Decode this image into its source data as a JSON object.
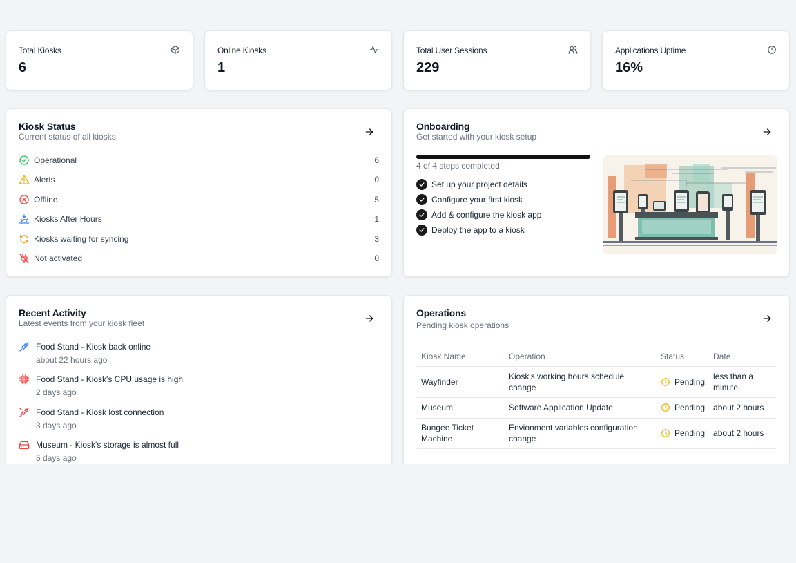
{
  "stats": [
    {
      "label": "Total Kiosks",
      "value": "6",
      "icon": "box-icon"
    },
    {
      "label": "Online Kiosks",
      "value": "1",
      "icon": "activity-icon"
    },
    {
      "label": "Total User Sessions",
      "value": "229",
      "icon": "users-icon"
    },
    {
      "label": "Applications Uptime",
      "value": "16%",
      "icon": "clock-icon"
    }
  ],
  "kiosk_status": {
    "title": "Kiosk Status",
    "subtitle": "Current status of all kiosks",
    "items": [
      {
        "label": "Operational",
        "count": "6",
        "icon": "check-circle-icon",
        "color": "#22c55e"
      },
      {
        "label": "Alerts",
        "count": "0",
        "icon": "warning-triangle-icon",
        "color": "#eab308"
      },
      {
        "label": "Offline",
        "count": "5",
        "icon": "x-circle-icon",
        "color": "#ef4444"
      },
      {
        "label": "Kiosks After Hours",
        "count": "1",
        "icon": "sunset-icon",
        "color": "#3b82f6"
      },
      {
        "label": "Kiosks waiting for syncing",
        "count": "3",
        "icon": "refresh-icon",
        "color": "#f59e0b"
      },
      {
        "label": "Not activated",
        "count": "0",
        "icon": "plug-off-icon",
        "color": "#ef4444"
      }
    ]
  },
  "onboarding": {
    "title": "Onboarding",
    "subtitle": "Get started with your kiosk setup",
    "progress": 1.0,
    "steps_text": "4 of 4 steps completed",
    "steps": [
      "Set up your project details",
      "Configure your first kiosk",
      "Add & configure the kiosk app",
      "Deploy the app to a kiosk"
    ]
  },
  "recent_activity": {
    "title": "Recent Activity",
    "subtitle": "Latest events from your kiosk fleet",
    "items": [
      {
        "text": "Food Stand - Kiosk back online",
        "time": "about 22 hours ago",
        "icon": "plug-connected-icon",
        "color": "#3b82f6"
      },
      {
        "text": "Food Stand - Kiosk's CPU usage is high",
        "time": "2 days ago",
        "icon": "cpu-icon",
        "color": "#ef4444"
      },
      {
        "text": "Food Stand - Kiosk lost connection",
        "time": "3 days ago",
        "icon": "plug-disconnected-icon",
        "color": "#ef4444"
      },
      {
        "text": "Museum - Kiosk's storage is almost full",
        "time": "5 days ago",
        "icon": "hard-drive-icon",
        "color": "#ef4444"
      }
    ]
  },
  "operations": {
    "title": "Operations",
    "subtitle": "Pending kiosk operations",
    "columns": [
      "Kiosk Name",
      "Operation",
      "Status",
      "Date"
    ],
    "rows": [
      {
        "kiosk": "Wayfinder",
        "operation": "Kiosk's working hours schedule change",
        "status": "Pending",
        "date": "less than a minute"
      },
      {
        "kiosk": "Museum",
        "operation": "Software Application Update",
        "status": "Pending",
        "date": "about 2 hours"
      },
      {
        "kiosk": "Bungee Ticket Machine",
        "operation": "Envionment variables configuration change",
        "status": "Pending",
        "date": "about 2 hours"
      }
    ]
  }
}
